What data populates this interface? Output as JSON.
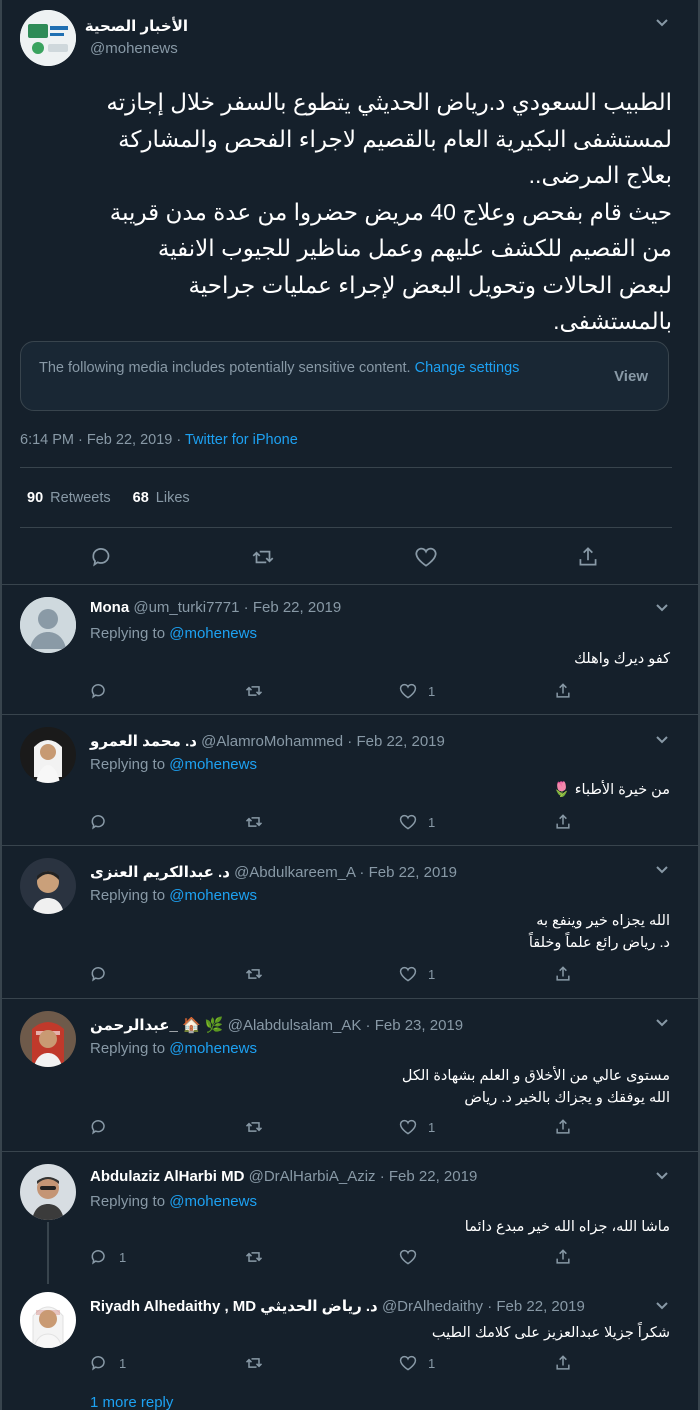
{
  "main_tweet": {
    "display_name": "الأخبار الصحية",
    "handle": "@mohenews",
    "text": "الطبيب السعودي د.رياض الحديثي يتطوع بالسفر خلال إجازته\nلمستشفى البكيرية العام بالقصيم لاجراء الفحص والمشاركة\nبعلاج المرضى..\nحيث قام بفحص وعلاج 40 مريض حضروا من عدة مدن قريبة\nمن القصيم للكشف عليهم وعمل مناظير للجيوب الانفية\nلبعض الحالات وتحويل البعض لإجراء عمليات جراحية\nبالمستشفى.",
    "sensitive_notice": "The following media includes potentially sensitive content.",
    "change_settings": "Change settings",
    "view_label": "View",
    "timestamp": "6:14 PM · Feb 22, 2019 · ",
    "source": "Twitter for iPhone",
    "retweets_count": "90",
    "retweets_label": "Retweets",
    "likes_count": "68",
    "likes_label": "Likes"
  },
  "replying_to_label": "Replying to",
  "replies": [
    {
      "name": "Mona",
      "handle": "@um_turki7771",
      "date": "Feb 22, 2019",
      "replying_to": "@mohenews",
      "text": "كفو ديرك واهلك",
      "likes": "1"
    },
    {
      "name": "د. محمد العمرو",
      "handle": "@AlamroMohammed",
      "date": "Feb 22, 2019",
      "replying_to": "@mohenews",
      "text": "من خيرة الأطباء 🌷",
      "likes": "1"
    },
    {
      "name": "د. عبدالكريم العنزى",
      "handle": "@Abdulkareem_A",
      "date": "Feb 22, 2019",
      "replying_to": "@mohenews",
      "text": "الله يجزاه خير وينفع به\nد. رياض رائع علماً وخلقاً",
      "likes": "1"
    },
    {
      "name": "عبدالرحمن_ 🏠 🌿",
      "handle": "@Alabdulsalam_AK",
      "date": "Feb 23, 2019",
      "replying_to": "@mohenews",
      "text": "مستوى عالي من الأخلاق و العلم بشهادة الكل\nالله يوفقك و يجزاك بالخير د. رياض",
      "likes": "1"
    },
    {
      "name": "Abdulaziz AlHarbi MD",
      "handle": "@DrAlHarbiA_Aziz",
      "date": "Feb 22, 2019",
      "replying_to": "@mohenews",
      "text": "ماشا الله، جزاه الله خير مبدع دائما",
      "replies": "1"
    },
    {
      "name": "Riyadh Alhedaithy , MD د. رياض الحديثي",
      "handle": "@DrAlhedaithy",
      "date": "Feb 22, 2019",
      "text": "شكراً جزيلا عبدالعزيز على كلامك الطيب",
      "replies": "1",
      "likes": "1"
    }
  ],
  "more_replies": "1 more reply",
  "colors": {
    "background": "#15202b",
    "border": "#38444d",
    "muted": "#8899a6",
    "link": "#1da1f2"
  },
  "icons": [
    "reply-icon",
    "retweet-icon",
    "like-icon",
    "share-icon",
    "chevron-down-icon"
  ]
}
